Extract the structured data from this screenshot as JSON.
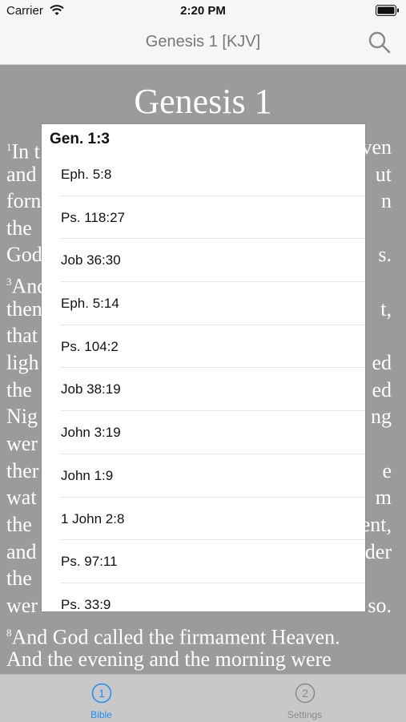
{
  "status_bar": {
    "carrier": "Carrier",
    "time": "2:20 PM"
  },
  "nav": {
    "title": "Genesis 1 [KJV]"
  },
  "reader": {
    "chapter_title": "Genesis 1",
    "visible_fragments": [
      {
        "text": "In t",
        "verse": "1"
      },
      {
        "text": "ven"
      },
      {
        "text": "and"
      },
      {
        "text": "ut"
      },
      {
        "text": "forn"
      },
      {
        "text": "n"
      },
      {
        "text": "the"
      },
      {
        "text": "God"
      },
      {
        "text": "s."
      },
      {
        "text": "And",
        "verse": "3"
      },
      {
        "text": "then"
      },
      {
        "text": "t,"
      },
      {
        "text": "that"
      },
      {
        "text": "ligh"
      },
      {
        "text": "ed"
      },
      {
        "text": "the"
      },
      {
        "text": "ed"
      },
      {
        "text": "Nig"
      },
      {
        "text": "ng"
      },
      {
        "text": "wer"
      },
      {
        "text": "ther"
      },
      {
        "text": "e"
      },
      {
        "text": "wat"
      },
      {
        "text": "m"
      },
      {
        "text": "the"
      },
      {
        "text": "ent,"
      },
      {
        "text": "and"
      },
      {
        "text": "der"
      },
      {
        "text": "the"
      },
      {
        "text": "wer"
      },
      {
        "text": "so."
      }
    ],
    "line_8": "And God called the firmament Heaven.",
    "verse_8_num": "8",
    "line_9": "And the evening and the morning were"
  },
  "popup": {
    "title": "Gen. 1:3",
    "references": [
      "Eph. 5:8",
      "Ps. 118:27",
      "Job 36:30",
      "Eph. 5:14",
      "Ps. 104:2",
      "Job 38:19",
      "John 3:19",
      "John 1:9",
      "1 John 2:8",
      "Ps. 97:11",
      "Ps. 33:9"
    ]
  },
  "tabs": [
    {
      "label": "Bible",
      "number": "1",
      "active": true
    },
    {
      "label": "Settings",
      "number": "2",
      "active": false
    }
  ],
  "colors": {
    "accent": "#1a8cff",
    "inactive": "#8a8a8a"
  }
}
